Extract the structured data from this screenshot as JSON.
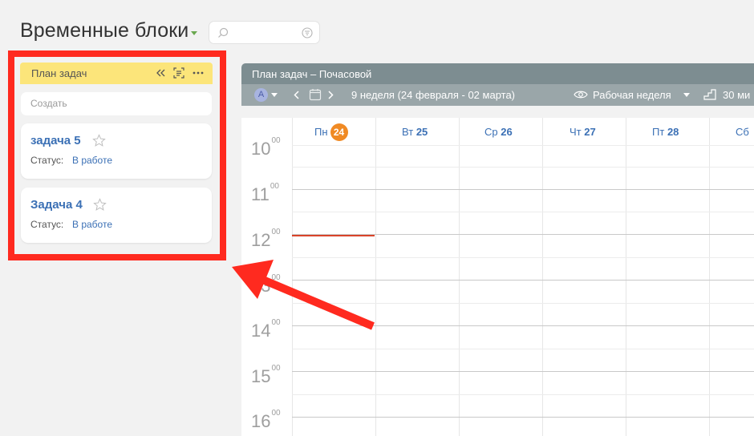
{
  "page": {
    "title": "Временные блоки",
    "search_placeholder": ""
  },
  "task_panel": {
    "title": "План задач",
    "create_placeholder": "Создать",
    "tasks": [
      {
        "name": "задача 5",
        "status_label": "Статус:",
        "status_value": "В работе"
      },
      {
        "name": "Задача 4",
        "status_label": "Статус:",
        "status_value": "В работе"
      }
    ]
  },
  "calendar": {
    "title": "План задач – Почасовой",
    "avatar_letter": "А",
    "week_label": "9 неделя (24 февраля - 02 марта)",
    "view_label": "Рабочая неделя",
    "scale_label": "30 ми",
    "days": [
      {
        "dow": "Пн",
        "num": "24",
        "today": true
      },
      {
        "dow": "Вт",
        "num": "25",
        "today": false
      },
      {
        "dow": "Ср",
        "num": "26",
        "today": false
      },
      {
        "dow": "Чт",
        "num": "27",
        "today": false
      },
      {
        "dow": "Пт",
        "num": "28",
        "today": false
      },
      {
        "dow": "Сб",
        "num": "",
        "today": false
      }
    ],
    "hours": [
      {
        "h": "10",
        "m": "00"
      },
      {
        "h": "11",
        "m": "00"
      },
      {
        "h": "12",
        "m": "00"
      },
      {
        "h": "13",
        "m": "00"
      },
      {
        "h": "14",
        "m": "00"
      },
      {
        "h": "15",
        "m": "00"
      },
      {
        "h": "16",
        "m": "00"
      }
    ]
  },
  "colors": {
    "highlight": "#ff2a1f",
    "panel_header": "#fce57a",
    "link": "#3b70b5",
    "today": "#f08a24",
    "calendar_header": "#7d8d91"
  }
}
